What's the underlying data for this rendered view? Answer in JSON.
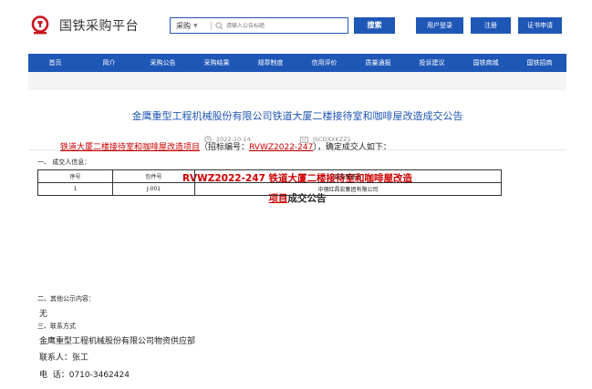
{
  "header": {
    "site_title": "国铁采购平台",
    "search_category": "采购",
    "search_placeholder": "请输入公告标题",
    "search_button": "搜索",
    "buttons": [
      "用户登录",
      "注册",
      "证书申请"
    ]
  },
  "nav": {
    "items": [
      "首页",
      "简介",
      "采购公告",
      "采购结果",
      "规章制度",
      "信用评价",
      "质量通报",
      "投诉建议",
      "国铁商城",
      "国铁招商"
    ]
  },
  "article": {
    "title": "金鹰重型工程机械股份有限公司铁道大厦二楼接待室和咖啡屋改造成交公告",
    "date": "2022-10-14",
    "code": "JSCDXXKZZ1",
    "doc_title_line1": "RVWZ2022-247 铁道大厦二楼接待室和咖啡屋改造",
    "doc_title_line2_red": "项目",
    "doc_title_line2_black": "成交公告",
    "intro_project": "铁道大厦二楼接待室和咖啡屋改造项目",
    "intro_mid": "（招标编号：",
    "intro_code": "RVWZ2022-247",
    "intro_end": "），确定成交人如下：",
    "section1": "一、 成交人信息：",
    "table_headers": [
      "序号",
      "包件号",
      "成交候选人"
    ],
    "table_rows": [
      [
        "1",
        "J-001",
        "中钢红昌宏集团有限公司"
      ]
    ],
    "section2": "二、其他公示内容：",
    "other_content": "无",
    "section3": "三、联系方式",
    "contact_company": "金鹰重型工程机械股份有限公司物资供应部",
    "contact_person": "联系人：张工",
    "contact_phone": "电  话：0710-3462424"
  },
  "colors": {
    "brand_blue": "#1f57b6",
    "red": "#c00000",
    "logo_red": "#c8161e"
  }
}
